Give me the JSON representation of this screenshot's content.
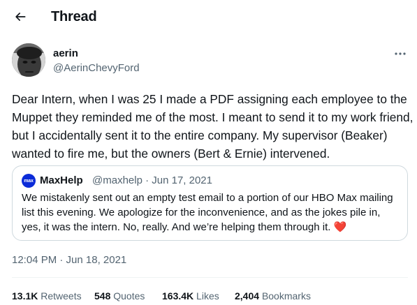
{
  "header": {
    "title": "Thread",
    "back_icon": "arrow-left-icon"
  },
  "tweet": {
    "author_name": "aerin",
    "author_handle": "@AerinChevyFord",
    "more_icon": "more-horizontal-icon",
    "text": "Dear Intern, when I was 25 I made a PDF assigning each employee to the Muppet they reminded me of the most. I meant to send it to my work friend, but I accidentally sent it to the entire company. My supervisor (Beaker) wanted to fire me, but the owners (Bert & Ernie) intervened.",
    "timestamp": "12:04 PM · Jun 18, 2021"
  },
  "quote": {
    "avatar_text": "max",
    "name": "MaxHelp",
    "meta": "@maxhelp · Jun 17, 2021",
    "text": "We mistakenly sent out an empty test email to a portion of our HBO Max mailing list this evening. We apologize for the inconvenience, and as the jokes pile in, yes, it was the intern. No, really. And we’re helping them through it.",
    "emoji": "❤️"
  },
  "stats": [
    {
      "value": "13.1K",
      "label": "Retweets"
    },
    {
      "value": "548",
      "label": "Quotes"
    },
    {
      "value": "163.4K",
      "label": "Likes"
    },
    {
      "value": "2,404",
      "label": "Bookmarks"
    }
  ],
  "colors": {
    "text": "#0f1419",
    "secondary": "#536471",
    "border": "#cfd9de",
    "hbo_blue": "#0b2bd8",
    "heart": "#e0245e"
  }
}
